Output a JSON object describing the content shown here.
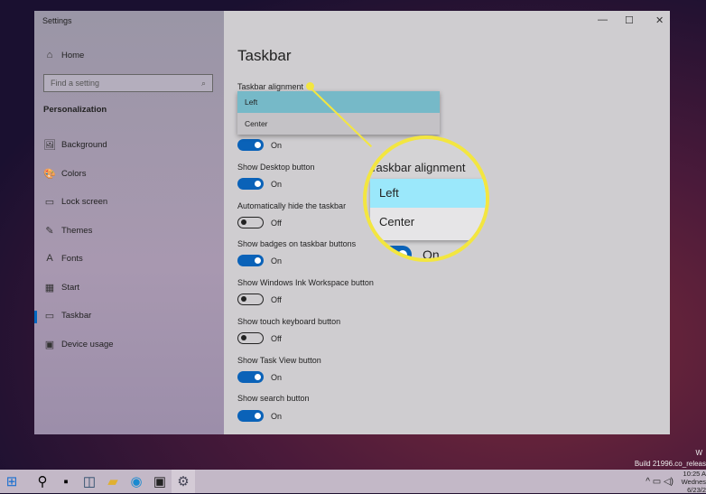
{
  "window": {
    "title": "Settings",
    "controls": [
      "—",
      "☐",
      "✕"
    ]
  },
  "sidebar": {
    "home": "Home",
    "search_placeholder": "Find a setting",
    "section": "Personalization",
    "items": [
      {
        "label": "Background",
        "icon": "🖼"
      },
      {
        "label": "Colors",
        "icon": "🎨"
      },
      {
        "label": "Lock screen",
        "icon": "▭"
      },
      {
        "label": "Themes",
        "icon": "✎"
      },
      {
        "label": "Fonts",
        "icon": "A"
      },
      {
        "label": "Start",
        "icon": "▦"
      },
      {
        "label": "Taskbar",
        "icon": "▭"
      },
      {
        "label": "Device usage",
        "icon": "▣"
      }
    ]
  },
  "main": {
    "title": "Taskbar",
    "alignment_label": "Taskbar alignment",
    "alignment_options": [
      "Left",
      "Center"
    ],
    "settings": [
      {
        "label": "",
        "state": "On"
      },
      {
        "label": "Show Desktop button",
        "state": "On"
      },
      {
        "label": "Automatically hide the taskbar",
        "state": "Off"
      },
      {
        "label": "Show badges on taskbar buttons",
        "state": "On"
      },
      {
        "label": "Show Windows Ink Workspace button",
        "state": "Off"
      },
      {
        "label": "Show touch keyboard button",
        "state": "Off"
      },
      {
        "label": "Show Task View button",
        "state": "On"
      },
      {
        "label": "Show search button",
        "state": "On"
      }
    ]
  },
  "magnifier": {
    "title": "Taskbar alignment",
    "options": [
      "Left",
      "Center"
    ],
    "state": "On"
  },
  "desktop": {
    "watermark1": "W",
    "watermark2": "Build 21996.co_releas"
  },
  "tray": {
    "time": "10:25 A",
    "day": "Wednes",
    "date": "6/23/2"
  },
  "colors": {
    "accent": "#0a62b8",
    "highlight": "#f3e640"
  }
}
